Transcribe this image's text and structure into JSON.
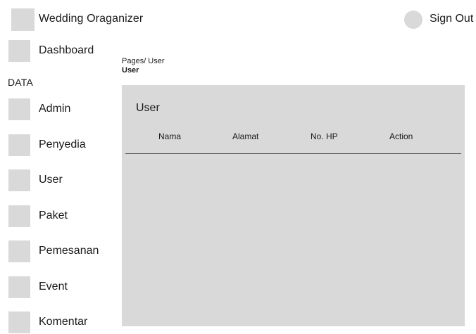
{
  "header": {
    "app_title": "Wedding Oraganizer",
    "sign_out_label": "Sign Out"
  },
  "sidebar": {
    "dashboard_label": "Dashboard",
    "section_label": "DATA",
    "items": [
      {
        "label": "Admin"
      },
      {
        "label": "Penyedia"
      },
      {
        "label": "User"
      },
      {
        "label": "Paket"
      },
      {
        "label": "Pemesanan"
      },
      {
        "label": "Event"
      },
      {
        "label": "Komentar"
      }
    ]
  },
  "breadcrumb": {
    "path": "Pages/ User",
    "current": "User"
  },
  "main": {
    "panel_title": "User",
    "table": {
      "columns": [
        "Nama",
        "Alamat",
        "No. HP",
        "Action"
      ],
      "rows": []
    }
  },
  "colors": {
    "placeholder_gray": "#d9d9d9",
    "text": "#1a1a1a",
    "divider": "#555555"
  }
}
